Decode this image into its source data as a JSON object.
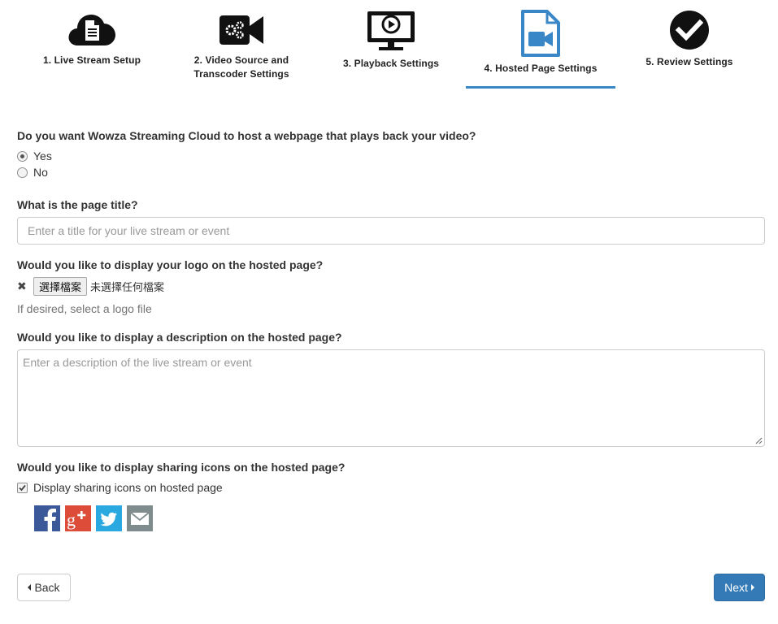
{
  "colors": {
    "active_step": "#3a87c8",
    "primary": "#337ab7",
    "icon": "#111111"
  },
  "steps": [
    {
      "label": "1. Live Stream Setup",
      "icon": "cloud-document-icon"
    },
    {
      "label": "2. Video Source and Transcoder Settings",
      "line1": "2. Video Source and",
      "line2": "Transcoder Settings",
      "icon": "video-gears-icon"
    },
    {
      "label": "3. Playback Settings",
      "icon": "monitor-play-icon"
    },
    {
      "label": "4. Hosted Page Settings",
      "icon": "video-file-icon",
      "active": true
    },
    {
      "label": "5. Review Settings",
      "icon": "check-circle-icon"
    }
  ],
  "form": {
    "host_question": "Do you want Wowza Streaming Cloud to host a webpage that plays back your video?",
    "yes_label": "Yes",
    "no_label": "No",
    "host_selected": "Yes",
    "title_question": "What is the page title?",
    "title_placeholder": "Enter a title for your live stream or event",
    "title_value": "",
    "logo_question": "Would you like to display your logo on the hosted page?",
    "file_button": "選擇檔案",
    "file_status": "未選擇任何檔案",
    "logo_help": "If desired, select a logo file",
    "desc_question": "Would you like to display a description on the hosted page?",
    "desc_placeholder": "Enter a description of the live stream or event",
    "desc_value": "",
    "sharing_question": "Would you like to display sharing icons on the hosted page?",
    "sharing_label": "Display sharing icons on hosted page",
    "sharing_checked": true,
    "sharing_icons": [
      "facebook-icon",
      "google-plus-icon",
      "twitter-icon",
      "email-icon"
    ]
  },
  "nav": {
    "back_label": "Back",
    "next_label": "Next"
  }
}
